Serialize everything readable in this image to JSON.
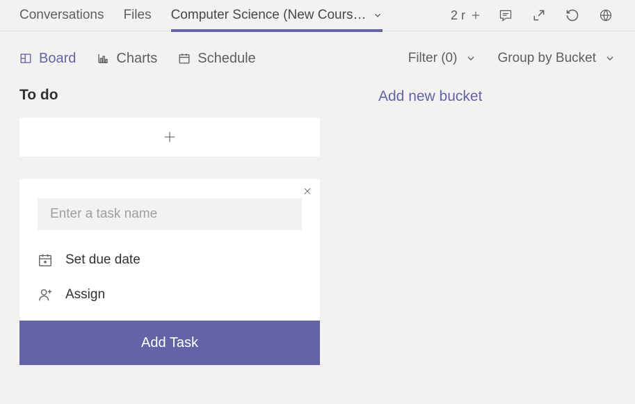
{
  "topTabs": {
    "conversations": "Conversations",
    "files": "Files",
    "activeTab": "Computer Science (New Cours…",
    "roomCount": "2 r"
  },
  "viewTabs": {
    "board": "Board",
    "charts": "Charts",
    "schedule": "Schedule"
  },
  "filters": {
    "filter": "Filter (0)",
    "groupBy": "Group by Bucket"
  },
  "bucket": {
    "title": "To do",
    "addNewBucket": "Add new bucket"
  },
  "taskForm": {
    "placeholder": "Enter a task name",
    "setDueDate": "Set due date",
    "assign": "Assign",
    "submit": "Add Task"
  }
}
